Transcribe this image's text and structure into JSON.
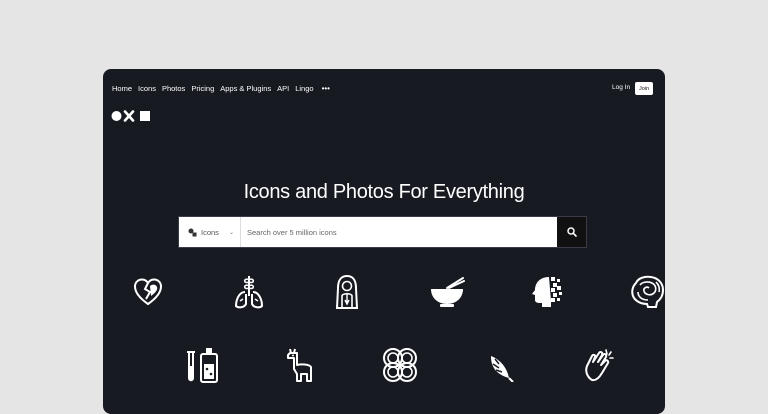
{
  "nav": {
    "items": [
      "Home",
      "Icons",
      "Photos",
      "Pricing",
      "Apps & Plugins",
      "API",
      "Lingo"
    ],
    "more": "•••",
    "login": "Log In",
    "join": "Join"
  },
  "hero": {
    "title": "Icons and Photos For Everything"
  },
  "search": {
    "type_label": "Icons",
    "placeholder": "Search over 5 million icons"
  },
  "icons": [
    "broken-heart-icon",
    "lungs-plant-icon",
    "praying-woman-icon",
    "noodle-bowl-icon",
    "pixel-head-icon",
    "brain-icon",
    "test-tubes-icon",
    "llama-icon",
    "knot-pattern-icon",
    "monstera-leaf-icon",
    "clapping-hands-icon"
  ],
  "colors": {
    "background": "#181a22",
    "page": "#e5e5e5",
    "text": "#ffffff"
  }
}
